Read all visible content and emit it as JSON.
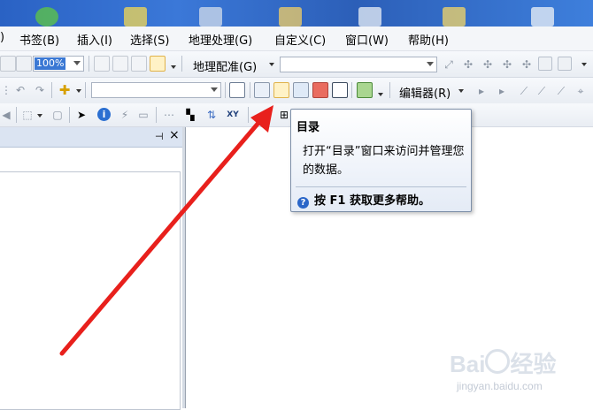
{
  "menubar": {
    "items": [
      {
        "label": ")"
      },
      {
        "label": "书签(B)"
      },
      {
        "label": "插入(I)"
      },
      {
        "label": "选择(S)"
      },
      {
        "label": "地理处理(G)"
      },
      {
        "label": "自定义(C)"
      },
      {
        "label": "窗口(W)"
      },
      {
        "label": "帮助(H)"
      }
    ]
  },
  "toolbar1": {
    "zoom_value": "100%",
    "georef_label": "地理配准(G)",
    "georef_layer_value": ""
  },
  "toolbar2": {
    "editor_label": "编辑器(R)",
    "layer_combo_value": ""
  },
  "tooltip": {
    "title": "目录",
    "body": "打开“目录”窗口来访问并管理您的数据。",
    "help_text": "按 F1 获取更多帮助。",
    "help_icon": "?"
  },
  "pane": {
    "pin_icon": "pin-icon",
    "close_symbol": "×"
  },
  "watermark": {
    "brand": "Bai",
    "brand2": "经验",
    "url": "jingyan.baidu.com"
  },
  "colors": {
    "arrow": "#e8201c",
    "desktop": "#2f67c6",
    "menubar": "#f4f6f9",
    "tooltip_border": "#7d8fa8"
  }
}
